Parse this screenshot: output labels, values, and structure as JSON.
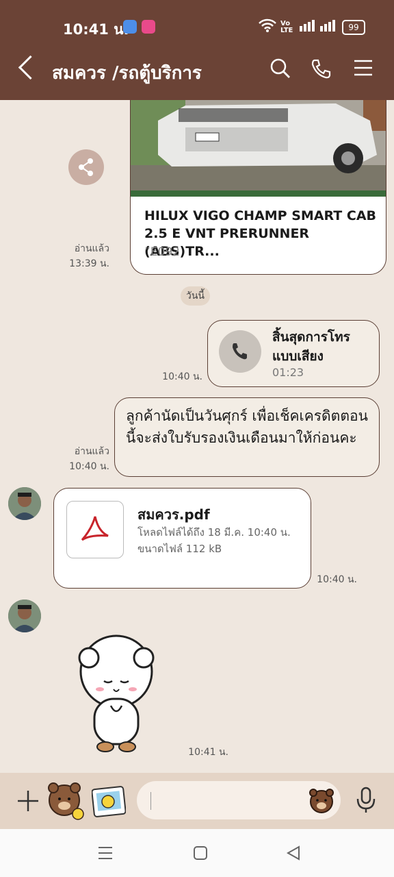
{
  "status": {
    "time": "10:41 น.",
    "battery": "99",
    "network_badge": "Vo\nLTE"
  },
  "header": {
    "title": "สมควร /รถตู้บริการ"
  },
  "card": {
    "title": "HILUX VIGO CHAMP SMART CAB 2.5 E VNT PRERUNNER (ABS)TR...",
    "subtitle": "”E092",
    "read_label": "อ่านแล้ว",
    "time": "13:39 น."
  },
  "date_separator": "วันนี้",
  "call_message": {
    "title": "สิ้นสุดการโทรแบบเสียง",
    "duration": "01:23",
    "time": "10:40 น."
  },
  "text_message": {
    "text": "ลูกค้านัดเป็นวันศุกร์ เพื่อเช็คเครดิตตอนนี้จะส่งใบรับรองเงินเดือนมาให้ก่อนคะ",
    "read_label": "อ่านแล้ว",
    "time": "10:40 น."
  },
  "file_message": {
    "name": "สมควร.pdf",
    "download_info": "โหลดไฟล์ได้ถึง 18 มี.ค. 10:40 น.",
    "size_info": "ขนาดไฟล์ 112 kB",
    "time": "10:40 น."
  },
  "sticker_message": {
    "time": "10:41 น."
  },
  "colors": {
    "header_bg": "#6b4336",
    "chat_bg": "#efe7df",
    "bubble_border": "#5a3e34",
    "input_bar_bg": "#e4d4c6"
  }
}
